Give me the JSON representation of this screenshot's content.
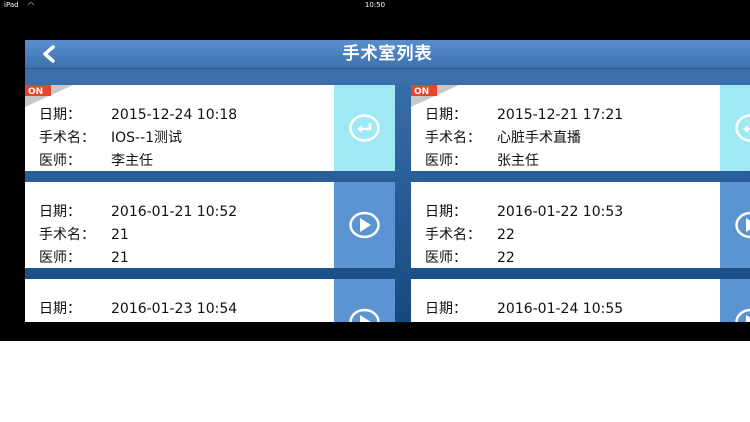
{
  "statusbar": {
    "carrier": "iPad",
    "time": "10:50"
  },
  "header": {
    "title": "手术室列表",
    "back_icon": "chevron-left-icon"
  },
  "labels": {
    "date": "日期：",
    "surgery": "手术名：",
    "doctor": "医师："
  },
  "cards": [
    {
      "on": true,
      "date": "2015-12-24 10:18",
      "surgery": "IOS--1测试",
      "doctor": "李主任",
      "action": "enter-icon",
      "action_color": "#9ee9f4",
      "badge": "ON"
    },
    {
      "on": true,
      "date": "2015-12-21 17:21",
      "surgery": "心脏手术直播",
      "doctor": "张主任",
      "action": "enter-icon",
      "action_color": "#9ee9f4",
      "badge": "ON"
    },
    {
      "on": false,
      "date": "2016-01-21 10:52",
      "surgery": "21",
      "doctor": "21",
      "action": "play-icon",
      "action_color": "#5b93d3"
    },
    {
      "on": false,
      "date": "2016-01-22 10:53",
      "surgery": "22",
      "doctor": "22",
      "action": "play-icon",
      "action_color": "#5b93d3"
    },
    {
      "on": false,
      "date": "2016-01-23 10:54",
      "action": "play-icon",
      "action_color": "#5b93d3"
    },
    {
      "on": false,
      "date": "2016-01-24 10:55",
      "action": "play-icon",
      "action_color": "#5b93d3"
    }
  ],
  "colors": {
    "nav": "#4a7fc0",
    "live_button": "#9ee9f4",
    "play_button": "#5b93d3",
    "on_badge": "#e8442c"
  }
}
